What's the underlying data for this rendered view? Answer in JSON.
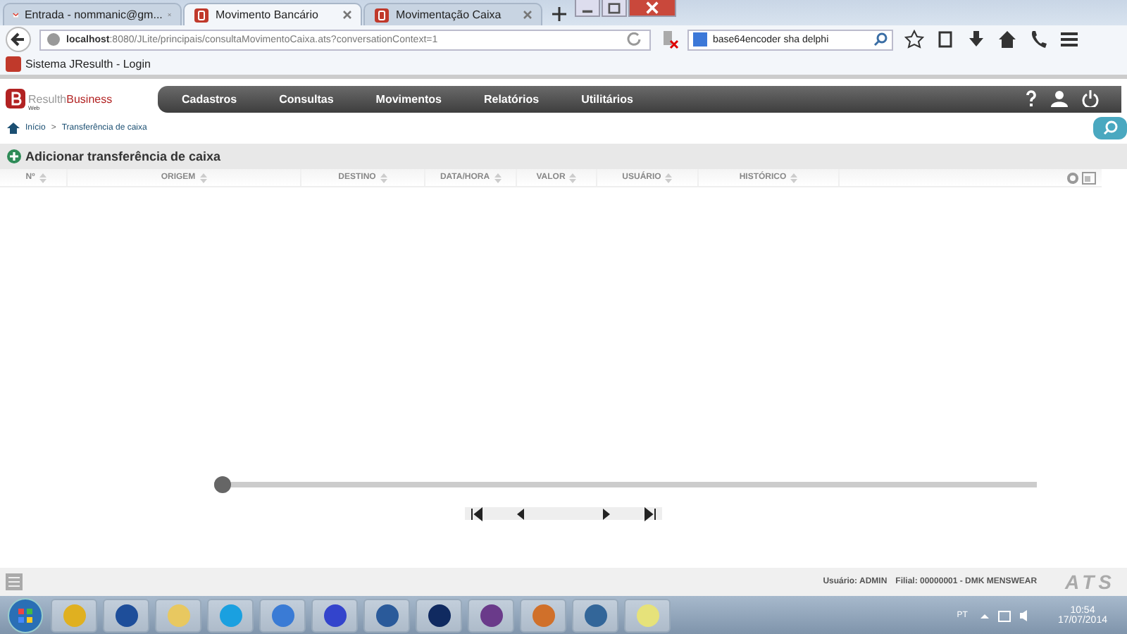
{
  "browser_tabs": [
    {
      "title": "Entrada - nommanic@gm...",
      "selected": false
    },
    {
      "title": "Movimento Bancário",
      "selected": true
    },
    {
      "title": "Movimentação Caixa",
      "selected": false
    }
  ],
  "address": {
    "host": "localhost",
    "path": ":8080/JLite/principais/consultaMovimentoCaixa.ats?conversationContext=1"
  },
  "search": {
    "value": "base64encoder sha delphi"
  },
  "bookmarks": [
    "Sistema JResulth - Login"
  ],
  "app": {
    "logo_main": "Resulth",
    "logo_accent": "Business",
    "logo_sub": "Web",
    "menu": [
      "Cadastros",
      "Consultas",
      "Movimentos",
      "Relatórios",
      "Utilitários"
    ],
    "breadcrumb": [
      "Início",
      ">",
      "Transferência de caixa"
    ],
    "page_title": "Adicionar transferência de caixa",
    "table": {
      "columns": [
        "Nº",
        "ORIGEM",
        "DESTINO",
        "DATA/HORA",
        "VALOR",
        "USUÁRIO",
        "HISTÓRICO"
      ]
    },
    "slider": {
      "level": 0
    },
    "status_bar": {
      "user": "Usuário: ADMIN",
      "branch": "Filial: 00000001 - DMK MENSWEAR",
      "brand": "ATS"
    }
  },
  "taskbar": {
    "language": "PT",
    "time": "10:54",
    "date": "17/07/2014"
  }
}
